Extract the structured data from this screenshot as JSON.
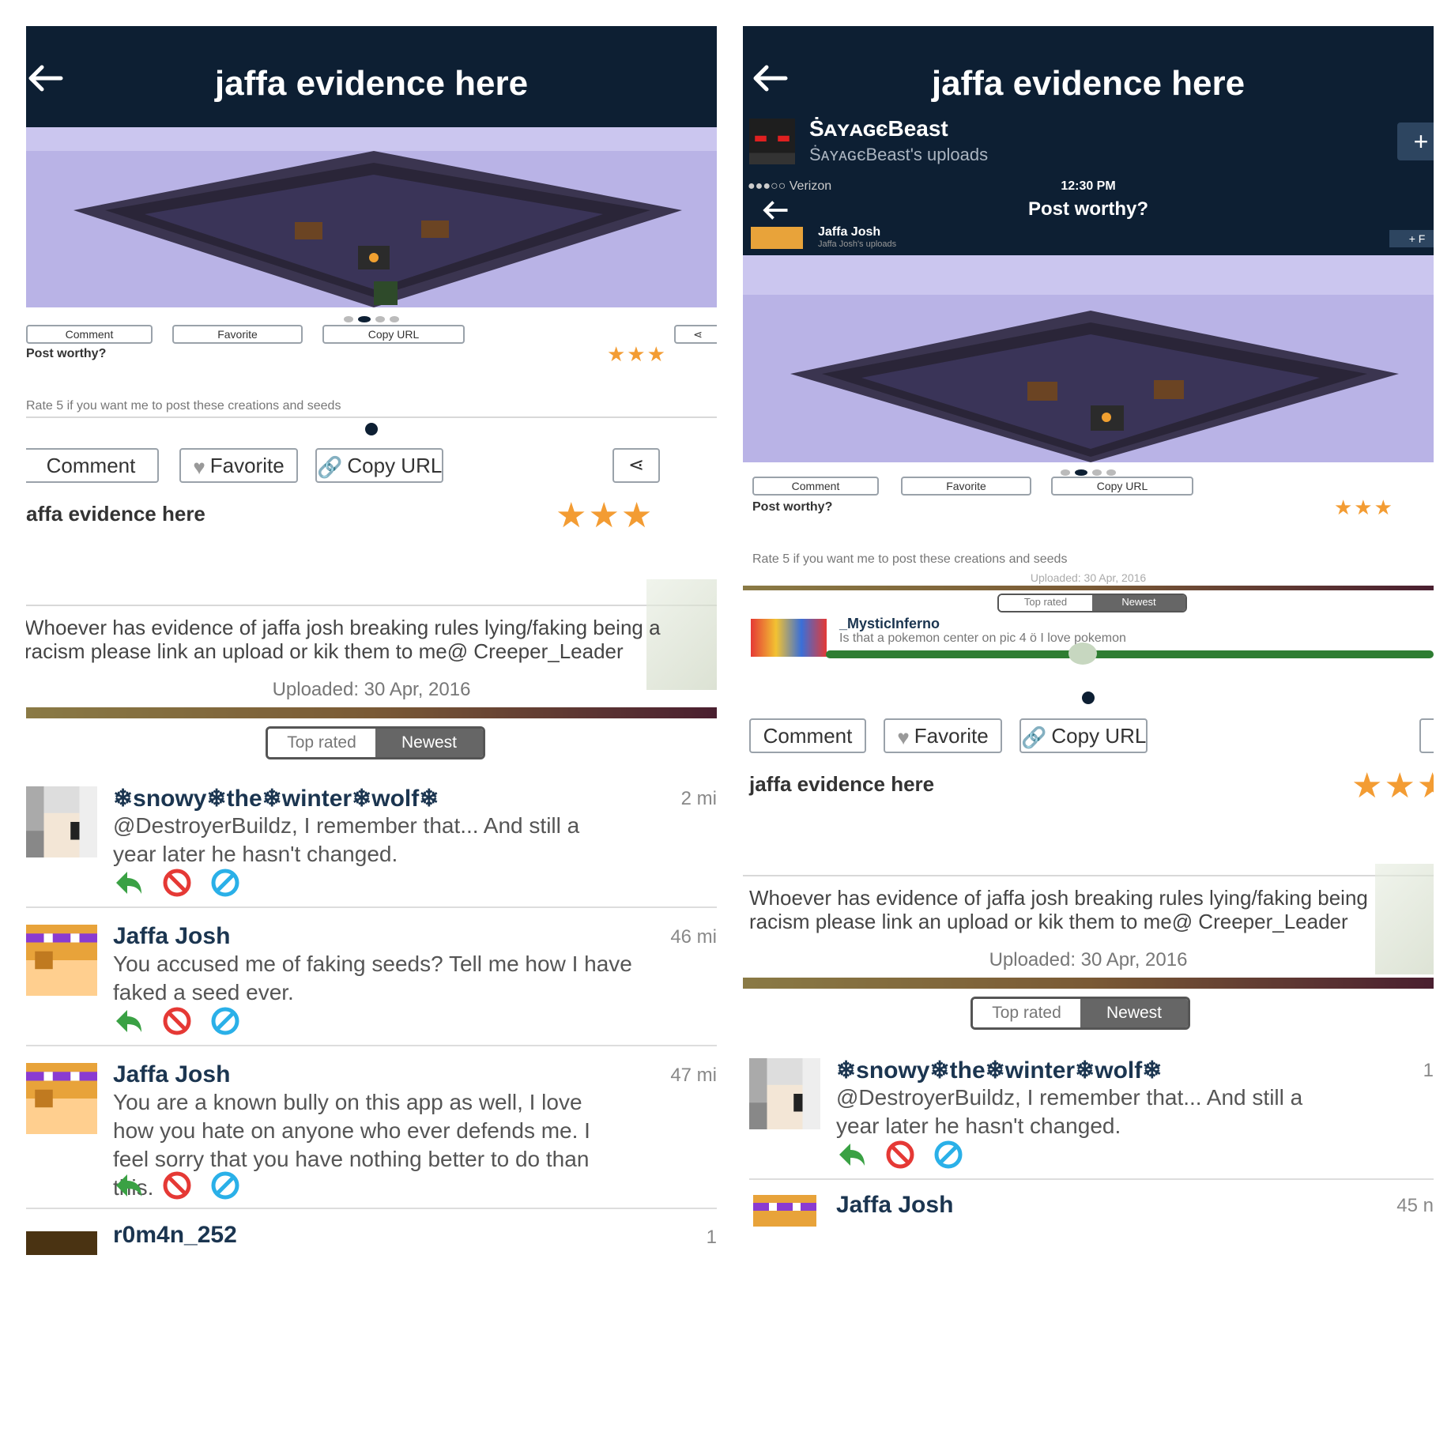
{
  "colors": {
    "nav_bg": "#0d1f33",
    "star": "#f39c33",
    "reply_green": "#3aa144",
    "ban_red": "#e53935",
    "block_blue": "#2ab0e8"
  },
  "left": {
    "nav_title": "jaffa evidence here",
    "embedded": {
      "button_comment": "Comment",
      "button_favorite": "Favorite",
      "button_copy": "Copy URL",
      "post_title": "Post worthy?",
      "description": "Rate 5 if you want me to post these creations and seeds"
    },
    "buttons": {
      "comment": "Comment",
      "favorite": "Favorite",
      "copy_url": "Copy URL"
    },
    "post_title": "affa evidence here",
    "stars": "★★★",
    "description_line1": "Whoever has evidence of jaffa josh breaking rules lying/faking being a",
    "description_line2": "racism please link an upload or kik them to me@ Creeper_Leader",
    "uploaded": "Uploaded: 30 Apr, 2016",
    "tabs": {
      "top_rated": "Top rated",
      "newest": "Newest"
    },
    "comments": [
      {
        "name": "❄snowy❄the❄winter❄wolf❄",
        "time": "2 mi",
        "text": "@DestroyerBuildz, I remember that... And still a year later he hasn't changed."
      },
      {
        "name": "Jaffa Josh",
        "time": "46 mi",
        "text": "You accused me of faking seeds? Tell me how I have faked a seed ever."
      },
      {
        "name": "Jaffa Josh",
        "time": "47 mi",
        "text": "You are a known bully on this app as well, I love how you hate on anyone who ever defends me. I feel sorry that you have nothing better to do than this."
      },
      {
        "name": "r0m4n_252",
        "time": "1",
        "text": ""
      }
    ]
  },
  "right": {
    "nav_title": "jaffa evidence here",
    "uploader": {
      "name": "ṠᴀʏᴀɢєBeast",
      "subtitle": "ṠᴀʏᴀɢєBeast's uploads",
      "follow": "+"
    },
    "embedded": {
      "carrier": "●●●○○ Verizon",
      "time": "12:30 PM",
      "title": "Post worthy?",
      "uploader_name": "Jaffa Josh",
      "uploader_sub": "Jaffa Josh's uploads",
      "follow": "+ F",
      "button_comment": "Comment",
      "button_favorite": "Favorite",
      "button_copy": "Copy URL",
      "post_title": "Post worthy?",
      "description": "Rate 5 if you want me to post these creations and seeds",
      "uploaded": "Uploaded: 30 Apr, 2016",
      "tab_top": "Top rated",
      "tab_new": "Newest",
      "comment_name": "_MysticInferno",
      "comment_text": "Is that a pokemon center on pic 4 ö I love pokemon"
    },
    "buttons": {
      "comment": "Comment",
      "favorite": "Favorite",
      "copy_url": "Copy URL"
    },
    "post_title": "jaffa evidence here",
    "stars": "★★★",
    "description_line1": "Whoever has evidence of jaffa josh breaking rules lying/faking being",
    "description_line2": "racism please link an upload or kik them to me@ Creeper_Leader",
    "uploaded": "Uploaded: 30 Apr, 2016",
    "tabs": {
      "top_rated": "Top rated",
      "newest": "Newest"
    },
    "comments": [
      {
        "name": "❄snowy❄the❄winter❄wolf❄",
        "time": "1",
        "text": "@DestroyerBuildz, I remember that... And still a year later he hasn't changed."
      },
      {
        "name": "Jaffa Josh",
        "time": "45 n",
        "text": ""
      }
    ]
  }
}
